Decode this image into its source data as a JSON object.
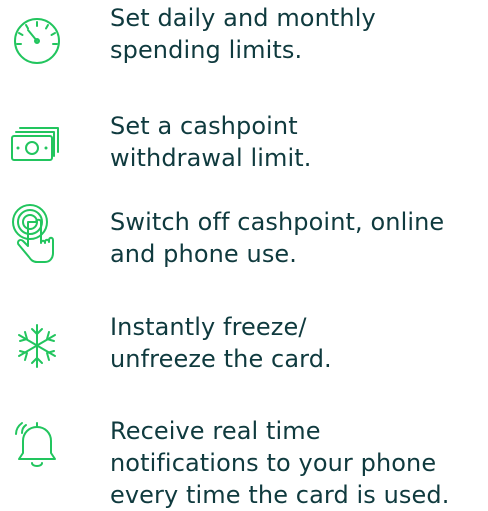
{
  "colors": {
    "icon": "#22c55e",
    "text": "#0f3a3e"
  },
  "features": [
    {
      "icon": "speedometer-icon",
      "lines": [
        "Set daily and monthly",
        "spending limits."
      ]
    },
    {
      "icon": "cash-stack-icon",
      "lines": [
        "Set a cashpoint",
        "withdrawal limit."
      ]
    },
    {
      "icon": "touch-tap-icon",
      "lines": [
        "Switch off cashpoint, online",
        "and phone use."
      ]
    },
    {
      "icon": "snowflake-icon",
      "lines": [
        "Instantly freeze/",
        "unfreeze the card."
      ]
    },
    {
      "icon": "bell-icon",
      "lines": [
        "Receive real time",
        "notifications to your phone",
        "every time the card is used."
      ]
    }
  ]
}
